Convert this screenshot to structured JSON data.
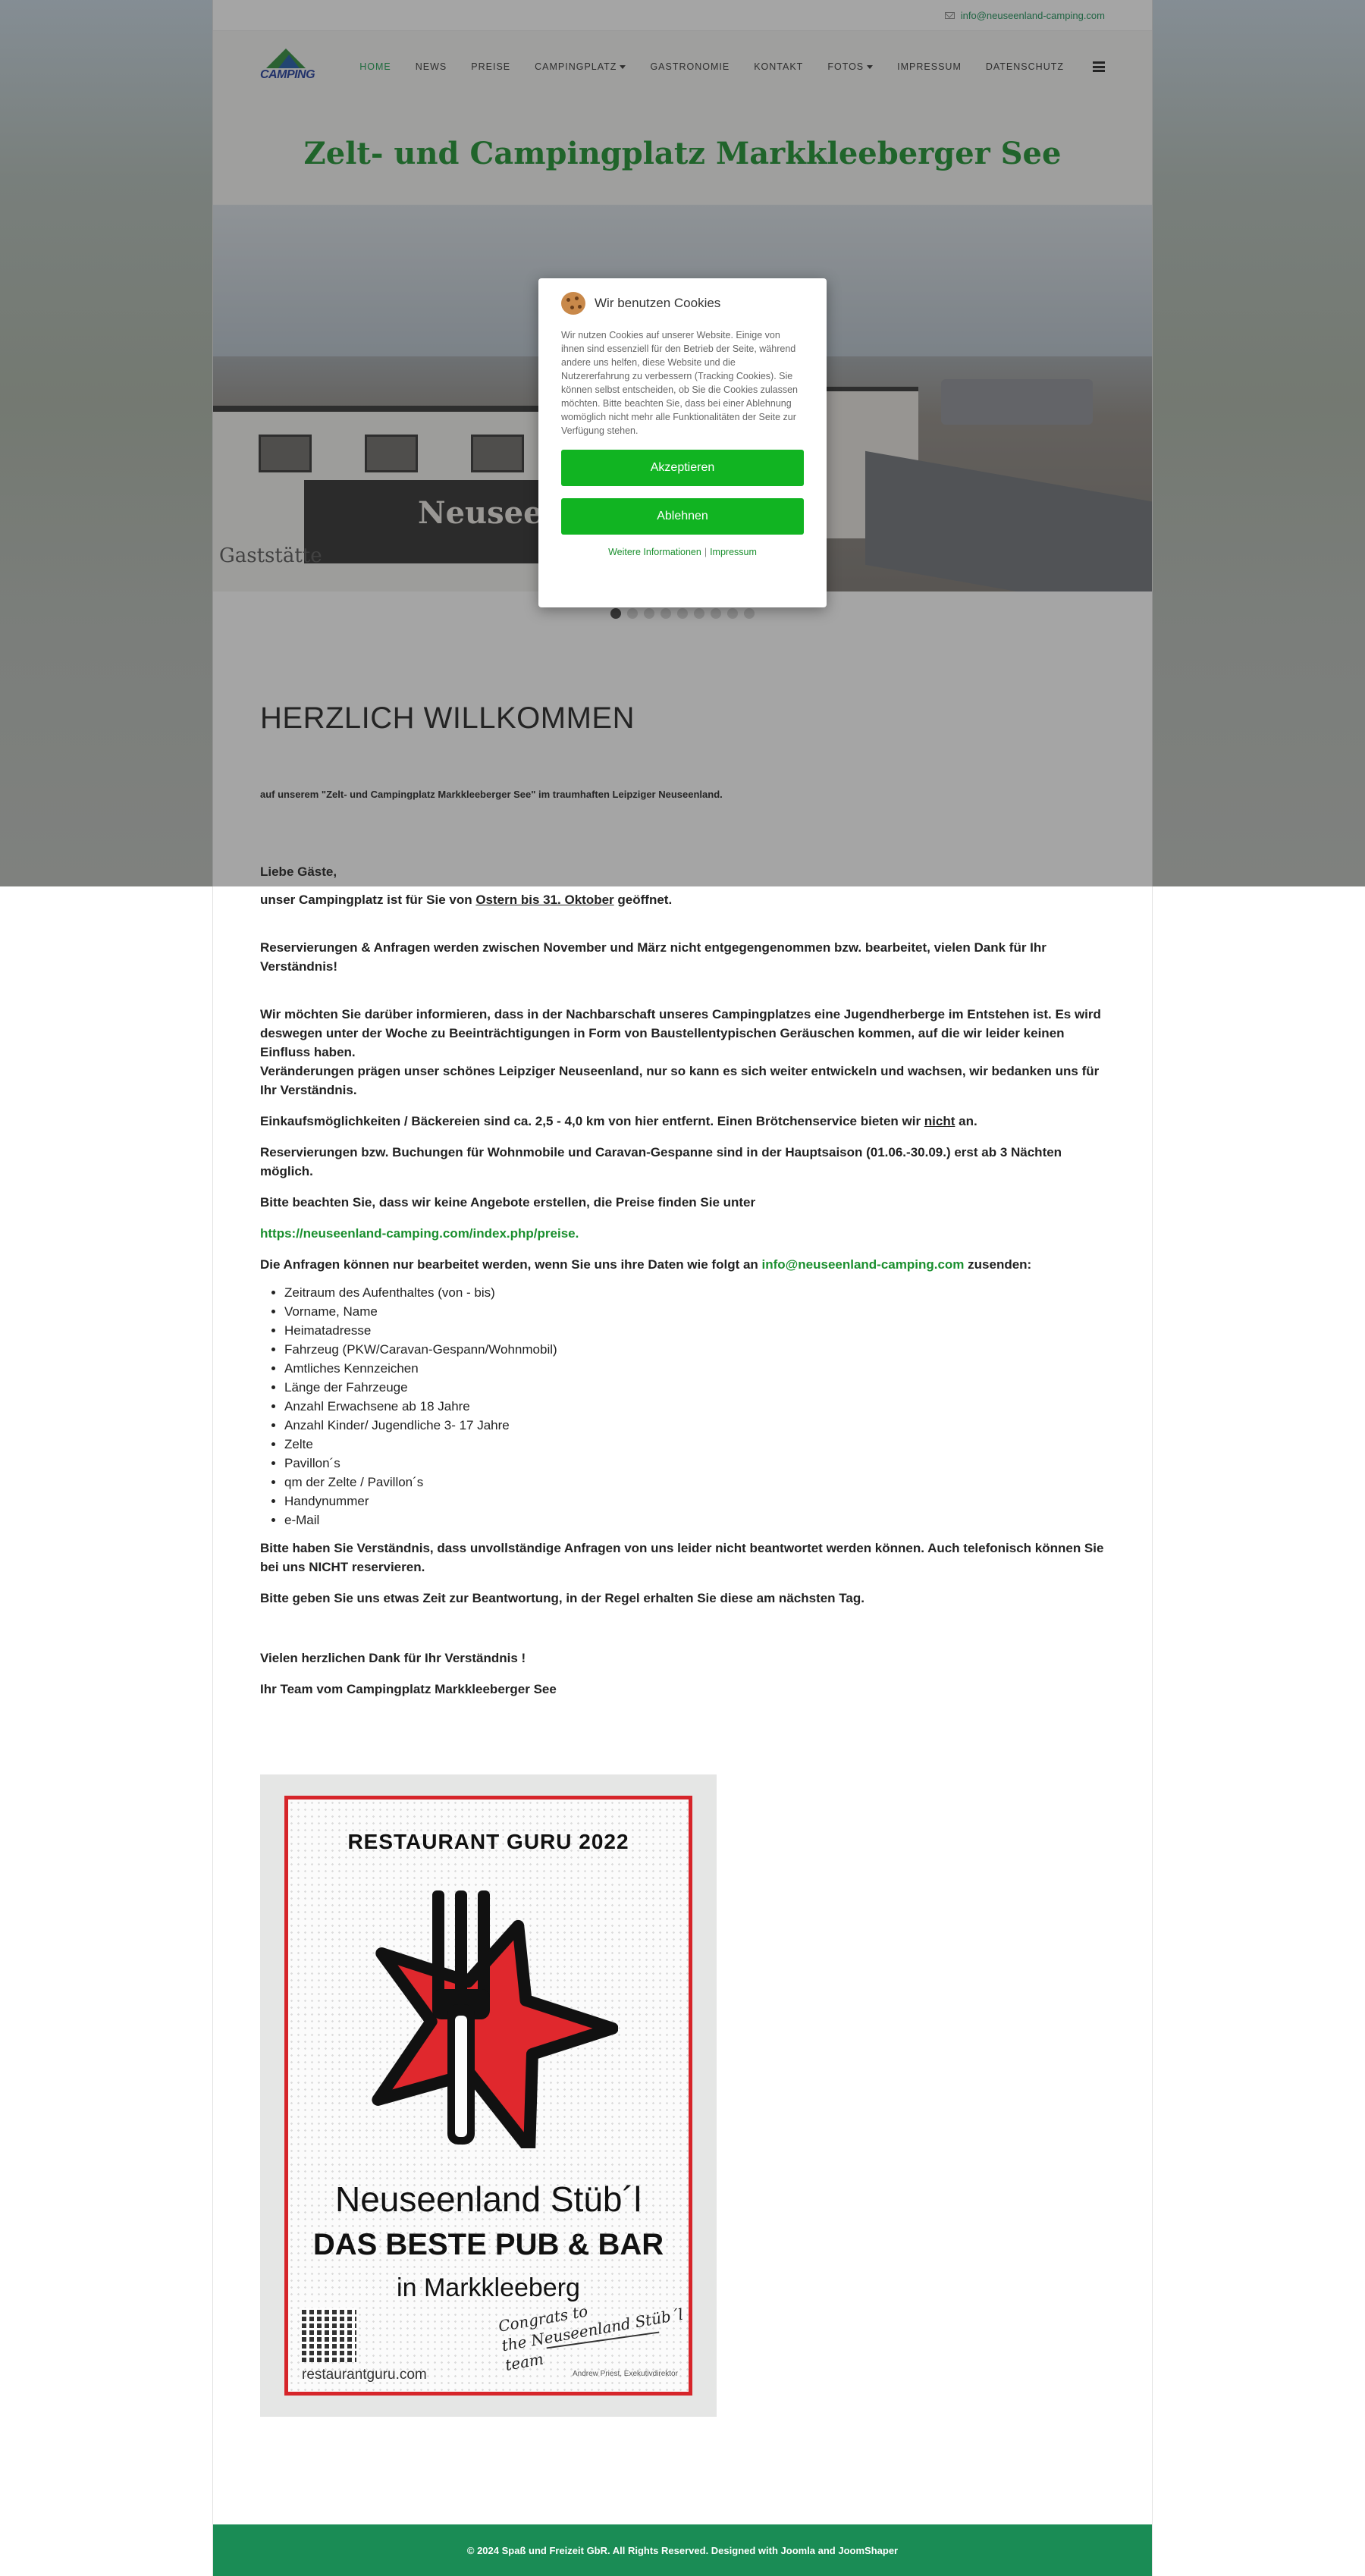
{
  "topbar": {
    "email": "info@neuseenland-camping.com"
  },
  "logo": {
    "text": "CAMPING"
  },
  "nav": {
    "items": [
      {
        "label": "HOME",
        "active": true,
        "dropdown": false
      },
      {
        "label": "NEWS",
        "active": false,
        "dropdown": false
      },
      {
        "label": "PREISE",
        "active": false,
        "dropdown": false
      },
      {
        "label": "CAMPINGPLATZ",
        "active": false,
        "dropdown": true
      },
      {
        "label": "GASTRONOMIE",
        "active": false,
        "dropdown": false
      },
      {
        "label": "KONTAKT",
        "active": false,
        "dropdown": false
      },
      {
        "label": "FOTOS",
        "active": false,
        "dropdown": true
      },
      {
        "label": "IMPRESSUM",
        "active": false,
        "dropdown": false
      },
      {
        "label": "DATENSCHUTZ",
        "active": false,
        "dropdown": false
      }
    ]
  },
  "hero": {
    "title": "Zelt- und Campingplatz Markkleeberger See",
    "sign_text": "Neuseen",
    "gaststaette": "Gaststätte",
    "slides": 9,
    "active_slide": 1
  },
  "content": {
    "heading": "HERZLICH WILLKOMMEN",
    "subheading": "auf unserem \"Zelt- und Campingplatz Markkleeberger See\" im traumhaften Leipziger Neuseenland.",
    "greeting": "Liebe Gäste,",
    "open_pre": "unser Campingplatz ist für Sie von ",
    "open_period": "Ostern bis 31. Oktober",
    "open_post": " geöffnet.",
    "reservations_note": "Reservierungen & Anfragen werden zwischen November und März nicht entgegengenommen bzw. bearbeitet, vielen Dank für Ihr Verständnis!",
    "hostel_note": "Wir möchten Sie darüber informieren, dass in der Nachbarschaft unseres Campingplatzes eine Jugendherberge im Entstehen ist. Es wird deswegen unter der Woche zu Beeinträchtigungen in Form von Baustellentypischen Geräuschen kommen, auf die wir leider keinen Einfluss haben.",
    "changes_note": "Veränderungen prägen unser schönes Leipziger Neuseenland, nur so kann es sich weiter entwickeln und wachsen, wir bedanken uns für Ihr Verständnis.",
    "shopping_pre": "Einkaufsmöglichkeiten / Bäckereien sind ca. 2,5 - 4,0 km von hier entfernt. Einen Brötchenservice bieten wir ",
    "shopping_not": "nicht",
    "shopping_post": " an.",
    "min_nights": "Reservierungen bzw. Buchungen für Wohnmobile und Caravan-Gespanne sind in der Hauptsaison (01.06.-30.09.) erst ab 3 Nächten möglich.",
    "no_offers": "Bitte beachten Sie, dass wir keine Angebote erstellen, die Preise finden Sie unter",
    "prices_link": "https://neuseenland-camping.com/index.php/preise",
    "prices_link_dot": ".",
    "request_pre": "Die Anfragen können nur bearbeitet werden, wenn Sie uns ihre Daten wie folgt an ",
    "request_email": "info@neuseenland-camping.com",
    "request_post": " zusenden:",
    "required_data": [
      "Zeitraum des Aufenthaltes (von - bis)",
      "Vorname, Name",
      "Heimatadresse",
      "Fahrzeug (PKW/Caravan-Gespann/Wohnmobil)",
      "Amtliches Kennzeichen",
      "Länge der Fahrzeuge",
      "Anzahl Erwachsene ab 18 Jahre",
      "Anzahl Kinder/ Jugendliche 3- 17 Jahre",
      "Zelte",
      "Pavillon´s",
      "qm der Zelte / Pavillon´s",
      "Handynummer",
      "e-Mail"
    ],
    "incomplete_note": "Bitte haben Sie Verständnis, dass unvollständige Anfragen von uns leider nicht beantwortet werden können. Auch telefonisch können Sie bei uns NICHT reservieren.",
    "response_time": "Bitte geben Sie uns etwas Zeit zur Beantwortung, in der Regel erhalten Sie diese am nächsten Tag.",
    "thanks": "Vielen herzlichen Dank für Ihr Verständnis !",
    "signoff": "Ihr Team vom Campingplatz Markkleeberger See"
  },
  "award": {
    "title": "RESTAURANT GURU 2022",
    "name": "Neuseenland Stüb´l",
    "best": "DAS BESTE PUB & BAR",
    "city": "in Markkleeberg",
    "url": "restaurantguru.com",
    "signature_line1": "Congrats to",
    "signature_line2": "the Neuseenland Stüb´l team",
    "author": "Andrew Priest, Exekutivdirektor",
    "colors": {
      "border": "#d6252a",
      "star": "#e0282d"
    }
  },
  "footer": {
    "text": "© 2024 Spaß und Freizeit GbR. All Rights Reserved. Designed with Joomla and JoomShaper"
  },
  "cookie": {
    "title": "Wir benutzen Cookies",
    "text": "Wir nutzen Cookies auf unserer Website. Einige von ihnen sind essenziell für den Betrieb der Seite, während andere uns helfen, diese Website und die Nutzererfahrung zu verbessern (Tracking Cookies). Sie können selbst entscheiden, ob Sie die Cookies zulassen möchten. Bitte beachten Sie, dass bei einer Ablehnung womöglich nicht mehr alle Funktionalitäten der Seite zur Verfügung stehen.",
    "accept": "Akzeptieren",
    "decline": "Ablehnen",
    "more_info": "Weitere Informationen",
    "separator": "|",
    "impressum": "Impressum",
    "button_color": "#11b422"
  },
  "colors": {
    "accent": "#1a8f2e",
    "footer": "#1a8c55"
  }
}
